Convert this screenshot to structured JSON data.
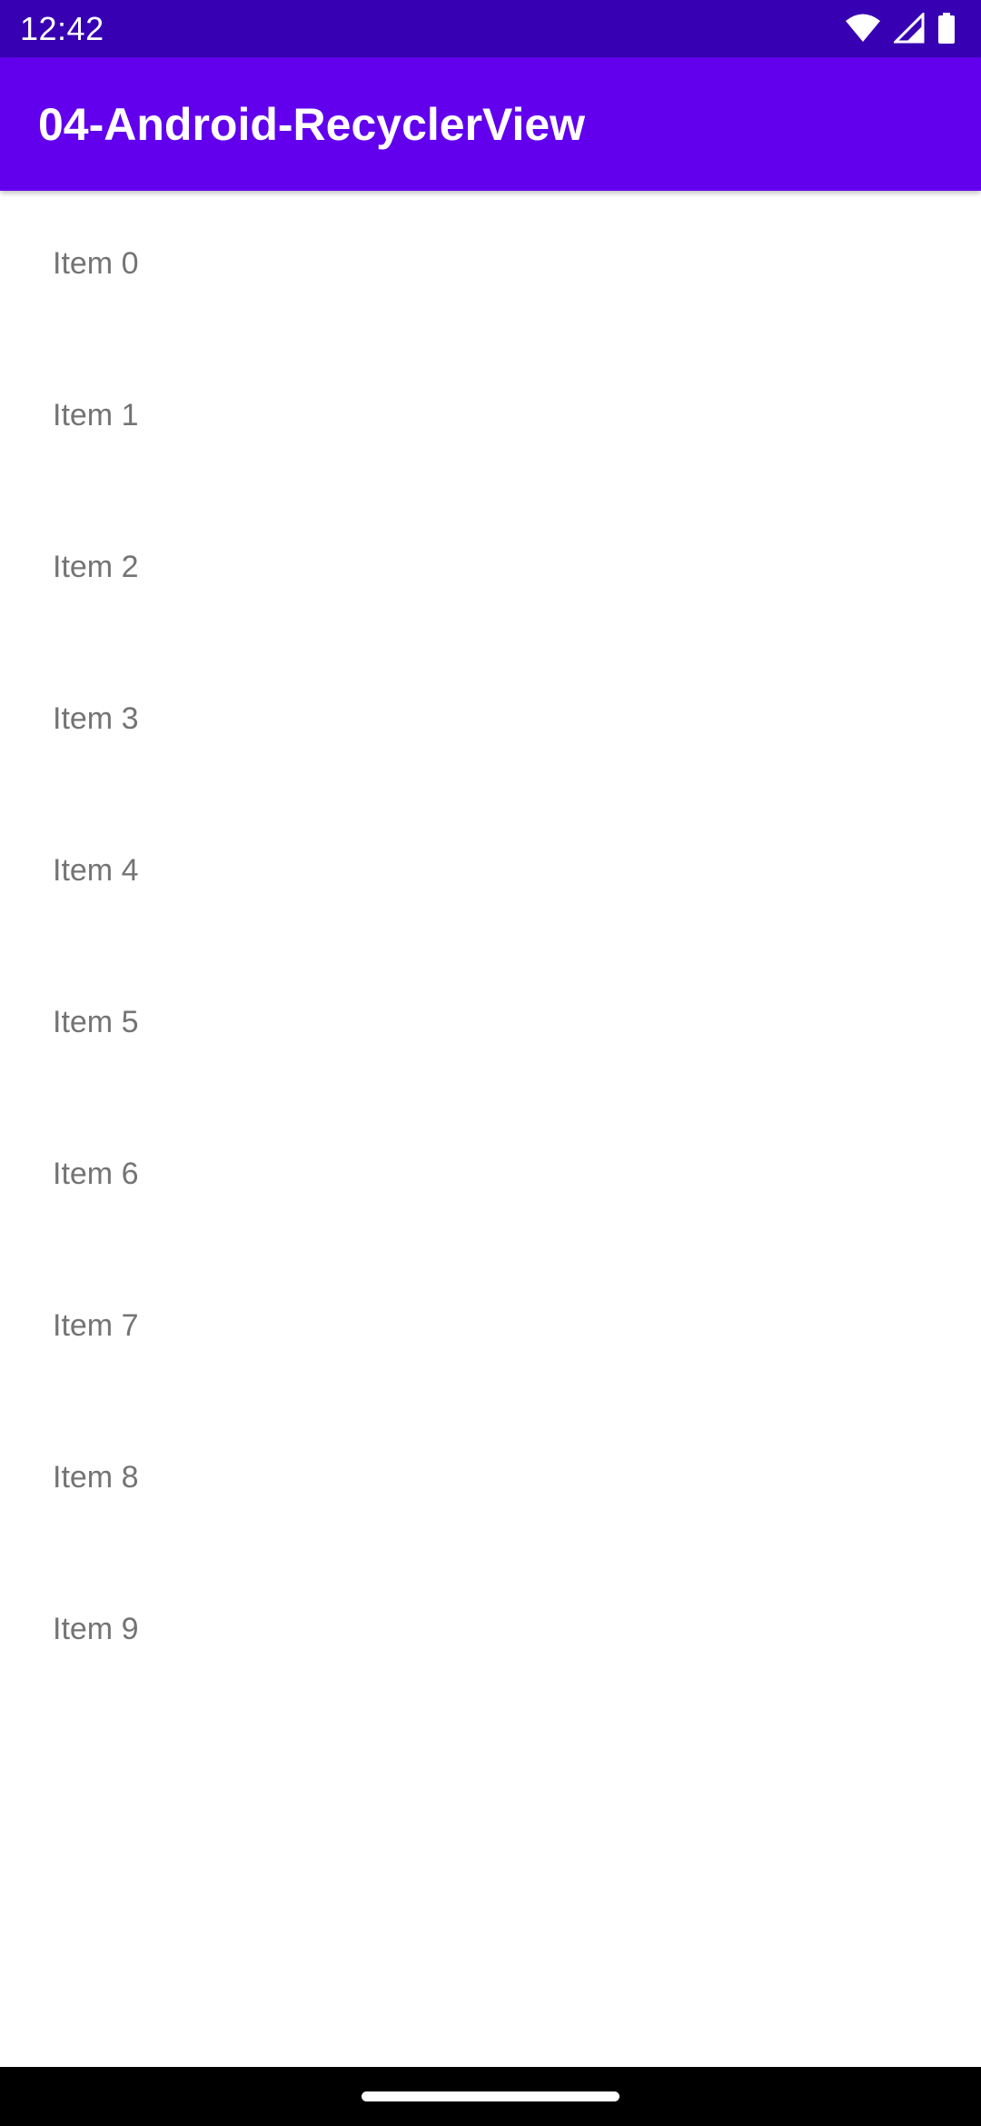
{
  "status_bar": {
    "time": "12:42",
    "icons": [
      "wifi-icon",
      "cellular-signal-icon",
      "battery-icon"
    ],
    "background": "#3700b3"
  },
  "app_bar": {
    "title": "04-Android-RecyclerView",
    "background": "#6200ee"
  },
  "list": {
    "items": [
      {
        "label": "Item 0"
      },
      {
        "label": "Item 1"
      },
      {
        "label": "Item 2"
      },
      {
        "label": "Item 3"
      },
      {
        "label": "Item 4"
      },
      {
        "label": "Item 5"
      },
      {
        "label": "Item 6"
      },
      {
        "label": "Item 7"
      },
      {
        "label": "Item 8"
      },
      {
        "label": "Item 9"
      }
    ]
  },
  "nav_bar": {
    "handle": "home-gesture-handle"
  }
}
